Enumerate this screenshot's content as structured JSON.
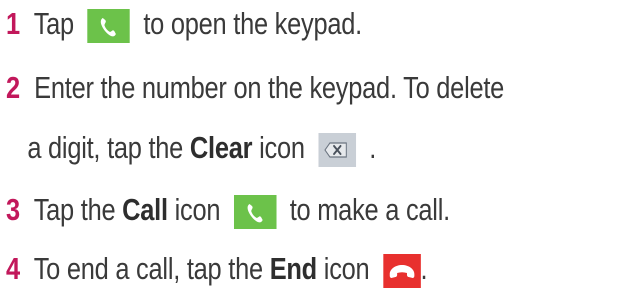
{
  "steps": [
    {
      "number": "1",
      "pre": "Tap",
      "icon": "phone-call-icon",
      "post": "to open the keypad."
    },
    {
      "number": "2",
      "line1": "Enter the number on the keypad. To delete",
      "line2_pre": "a digit, tap the",
      "keyword": "Clear",
      "line2_mid": "icon",
      "icon": "backspace-clear-icon",
      "post": "."
    },
    {
      "number": "3",
      "pre": "Tap the",
      "keyword": "Call",
      "mid": "icon",
      "icon": "phone-call-icon",
      "post": "to make a call."
    },
    {
      "number": "4",
      "pre": "To end a call, tap the",
      "keyword": "End",
      "mid": "icon",
      "icon": "end-call-icon",
      "post": "."
    }
  ],
  "colors": {
    "step_number": "#c2185b",
    "call_icon_bg": "#6cc24a",
    "clear_icon_bg": "#c9cfd6",
    "end_icon_bg": "#e8302e"
  }
}
